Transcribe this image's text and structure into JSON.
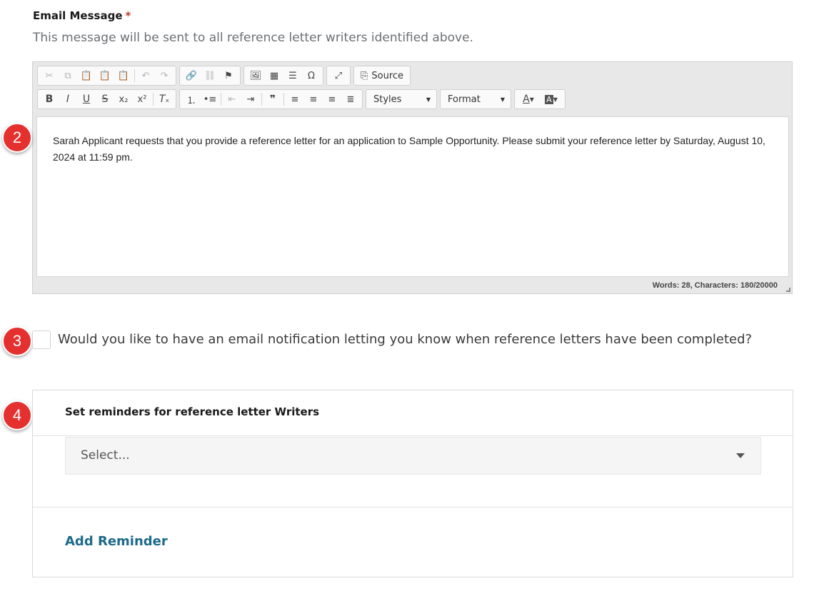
{
  "email": {
    "label": "Email Message",
    "required_mark": "*",
    "help": "This message will be sent to all reference letter writers identified above."
  },
  "editor": {
    "toolbar": {
      "source_label": "Source",
      "styles_label": "Styles",
      "format_label": "Format"
    },
    "content": "Sarah Applicant requests that you provide a reference letter for an application to Sample Opportunity. Please submit your reference letter by Saturday, August 10, 2024 at 11:59 pm.",
    "word_count": "Words: 28, Characters: 180/20000"
  },
  "badges": {
    "two": "2",
    "three": "3",
    "four": "4"
  },
  "notify": {
    "label": "Would you like to have an email notification letting you know when reference letters have been completed?"
  },
  "reminders": {
    "title": "Set reminders for reference letter Writers",
    "select_value": "Select...",
    "add_label": "Add Reminder"
  },
  "colors": {
    "badge": "#e4312f",
    "link": "#1d6a8a",
    "required": "#c0392b"
  }
}
